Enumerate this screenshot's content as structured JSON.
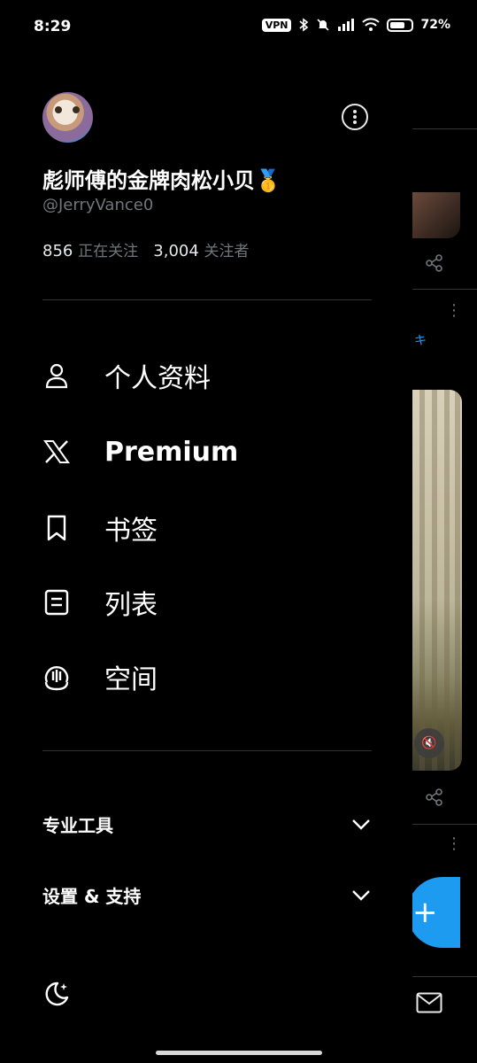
{
  "status_bar": {
    "time": "8:29",
    "vpn": "VPN",
    "battery_pct": "72%",
    "battery_level": 0.72
  },
  "profile": {
    "display_name": "彪师傅的金牌肉松小贝🥇",
    "handle": "@JerryVance0",
    "following_count": "856",
    "following_label": "正在关注",
    "followers_count": "3,004",
    "followers_label": "关注者"
  },
  "menu": [
    {
      "label": "个人资料",
      "icon": "person-icon"
    },
    {
      "label": "Premium",
      "icon": "x-logo-icon"
    },
    {
      "label": "书签",
      "icon": "bookmark-icon"
    },
    {
      "label": "列表",
      "icon": "list-icon"
    },
    {
      "label": "空间",
      "icon": "spaces-icon"
    }
  ],
  "sections": [
    {
      "label": "专业工具",
      "icon": "chevron-down-icon"
    },
    {
      "label": "设置 & 支持",
      "icon": "chevron-down-icon"
    }
  ],
  "feed": {
    "blue_tag": "キ",
    "fab_label": "+"
  },
  "colors": {
    "background": "#000000",
    "text": "#e7e9ea",
    "muted": "#71767b",
    "divider": "#2f3336",
    "accent": "#1d9bf0"
  }
}
